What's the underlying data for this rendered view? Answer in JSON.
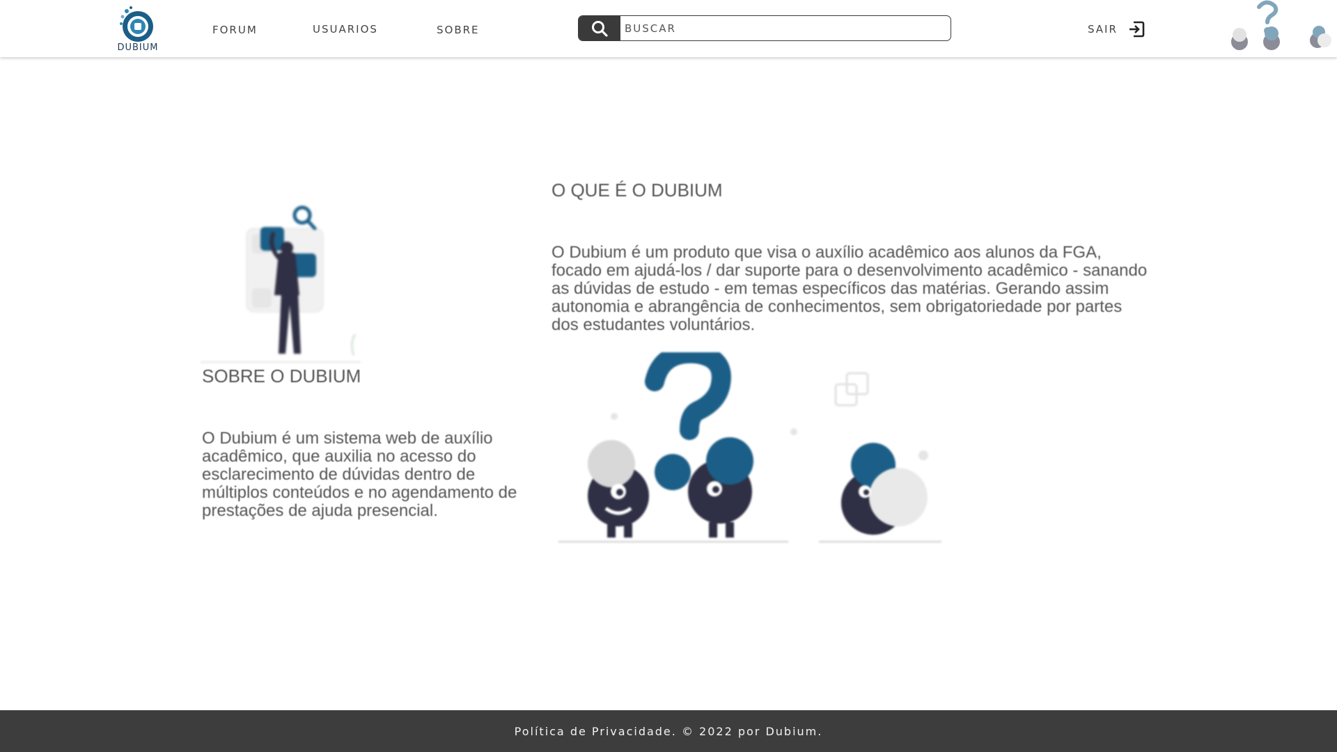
{
  "header": {
    "logo_text": "DUBIUM",
    "nav": {
      "forum": "FORUM",
      "usuarios": "USUARIOS",
      "sobre": "SOBRE"
    },
    "search": {
      "placeholder": "BUSCAR",
      "icon": "search-icon"
    },
    "logout": {
      "label": "SAIR",
      "icon": "logout-icon"
    }
  },
  "main": {
    "about": {
      "title": "SOBRE O DUBIUM",
      "text": "O Dubium é um sistema web de auxílio acadêmico, que auxilia no acesso do esclarecimento de dúvidas dentro de múltiplos conteúdos e no agendamento de prestações de ajuda presencial."
    },
    "what": {
      "title": "O QUE É O DUBIUM",
      "text": "O Dubium é um produto que visa o auxílio acadêmico aos alunos da FGA, focado em ajudá-los / dar suporte para o desenvolvimento acadêmico - sanando as dúvidas de estudo - em temas específicos das matérias. Gerando assim autonomia e abrangência de conhecimentos, sem obrigatoriedade por partes dos estudantes voluntários."
    }
  },
  "footer": {
    "text": "Política de Privacidade. © 2022 por Dubium."
  },
  "colors": {
    "brand_blue": "#1b5e87",
    "dark": "#3a3a3a",
    "figure": "#2f2f45",
    "footer_bg": "#3d3d3d"
  }
}
